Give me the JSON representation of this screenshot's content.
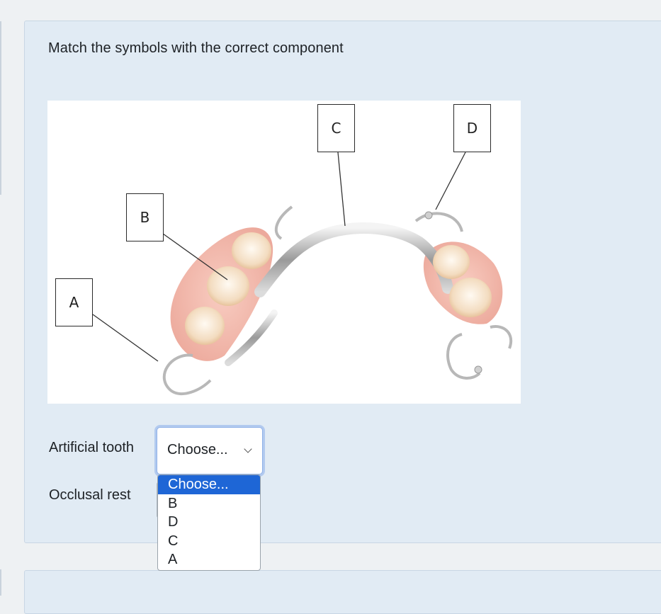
{
  "question": {
    "text": "Match the symbols with the correct component"
  },
  "figure": {
    "labels": [
      "A",
      "B",
      "C",
      "D"
    ]
  },
  "rows": [
    {
      "label": "Artificial tooth",
      "selected": "Choose..."
    },
    {
      "label": "Occlusal rest",
      "selected": "Choose..."
    }
  ],
  "dropdown": {
    "options": [
      "Choose...",
      "B",
      "D",
      "C",
      "A"
    ],
    "highlighted": "Choose..."
  },
  "colors": {
    "card_bg": "#e1ebf4",
    "highlight": "#1e66d6",
    "focus_ring": "#8fb1e8"
  }
}
